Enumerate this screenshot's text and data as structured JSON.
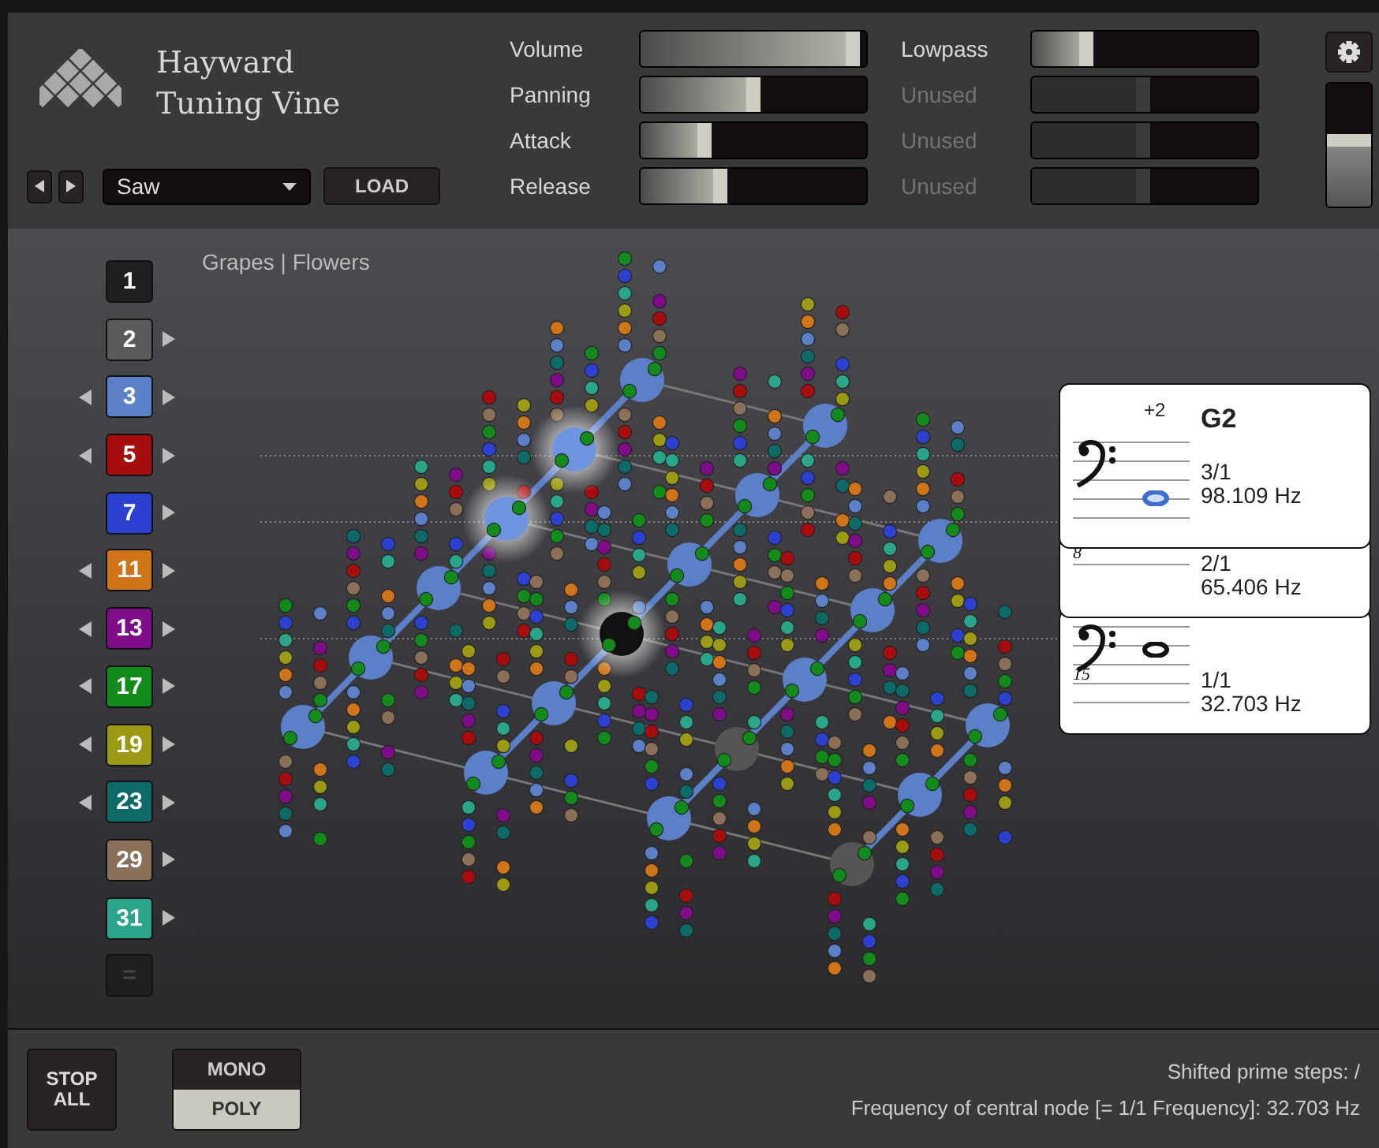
{
  "app": {
    "title_lines": [
      "Hayward",
      "Tuning Vine"
    ]
  },
  "preset": {
    "value": "Saw",
    "load_label": "LOAD"
  },
  "synth_sliders": [
    {
      "label": "Volume",
      "level": 0.94,
      "disabled": false
    },
    {
      "label": "Panning",
      "level": 0.5,
      "disabled": false
    },
    {
      "label": "Attack",
      "level": 0.28,
      "disabled": false
    },
    {
      "label": "Release",
      "level": 0.35,
      "disabled": false
    }
  ],
  "filter_sliders": [
    {
      "label": "Lowpass",
      "level": 0.24,
      "disabled": false
    },
    {
      "label": "Unused",
      "level": 0.49,
      "disabled": true
    },
    {
      "label": "Unused",
      "level": 0.49,
      "disabled": true
    },
    {
      "label": "Unused",
      "level": 0.49,
      "disabled": true
    }
  ],
  "master_slider": {
    "level": 0.54
  },
  "view_label": "Grapes | Flowers",
  "primes": [
    {
      "label": "1",
      "color": "#1f1f1f",
      "left_arrow": false,
      "right_arrow": false,
      "disabled": false
    },
    {
      "label": "2",
      "color": "#5a5a5a",
      "left_arrow": false,
      "right_arrow": true,
      "disabled": false
    },
    {
      "label": "3",
      "color": "#5b80c8",
      "left_arrow": true,
      "right_arrow": true,
      "disabled": false
    },
    {
      "label": "5",
      "color": "#a80d0d",
      "left_arrow": true,
      "right_arrow": true,
      "disabled": false
    },
    {
      "label": "7",
      "color": "#2c41d2",
      "left_arrow": false,
      "right_arrow": true,
      "disabled": false
    },
    {
      "label": "11",
      "color": "#d0741a",
      "left_arrow": true,
      "right_arrow": true,
      "disabled": false
    },
    {
      "label": "13",
      "color": "#7e0b88",
      "left_arrow": true,
      "right_arrow": true,
      "disabled": false
    },
    {
      "label": "17",
      "color": "#138a1c",
      "left_arrow": true,
      "right_arrow": true,
      "disabled": false
    },
    {
      "label": "19",
      "color": "#9a9a14",
      "left_arrow": true,
      "right_arrow": true,
      "disabled": false
    },
    {
      "label": "23",
      "color": "#0d6a66",
      "left_arrow": true,
      "right_arrow": true,
      "disabled": false
    },
    {
      "label": "29",
      "color": "#8a7058",
      "left_arrow": false,
      "right_arrow": true,
      "disabled": false
    },
    {
      "label": "31",
      "color": "#2aa58a",
      "left_arrow": false,
      "right_arrow": true,
      "disabled": false
    },
    {
      "label": "=",
      "color": "#1f1f1f",
      "left_arrow": false,
      "right_arrow": false,
      "disabled": true
    }
  ],
  "notes": [
    {
      "kind": "full",
      "offset": "+2",
      "name": "G2",
      "ratio": "3/1",
      "frequency": "98.109 Hz",
      "highlighted": true
    },
    {
      "kind": "covered",
      "octave_mark": "8",
      "ratio": "2/1",
      "frequency": "65.406 Hz"
    },
    {
      "kind": "full",
      "octave_mark": "15",
      "ratio": "1/1",
      "frequency": "32.703 Hz",
      "highlighted": false
    }
  ],
  "stop_all": "STOP ALL",
  "voice_modes": [
    {
      "label": "MONO",
      "selected": false
    },
    {
      "label": "POLY",
      "selected": true
    }
  ],
  "status": [
    "Shifted prime steps: /",
    "Frequency of central node [= 1/1 Frequency]: 32.703 Hz"
  ]
}
